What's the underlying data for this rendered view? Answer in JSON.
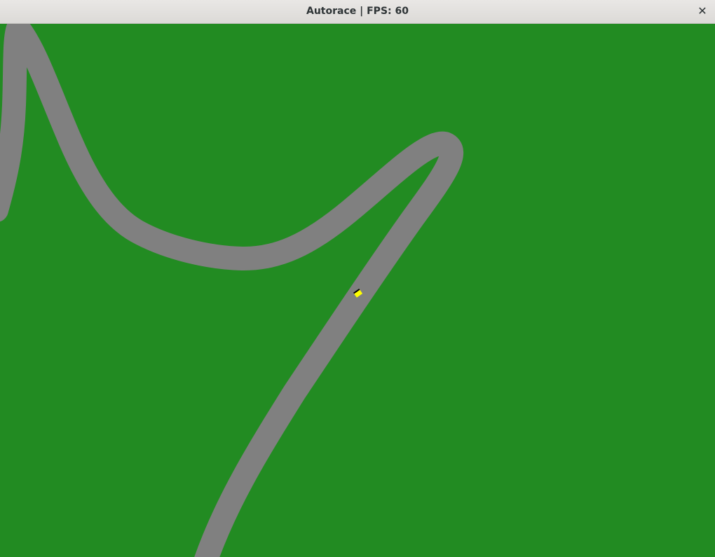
{
  "window": {
    "title": "Autorace | FPS: 60",
    "close_glyph": "✕",
    "close_icon": "close-icon"
  },
  "scene": {
    "grass_color": "#228b22",
    "track_color": "#808080",
    "car_color": "#ffff00",
    "car_stripe_color": "#000000"
  }
}
